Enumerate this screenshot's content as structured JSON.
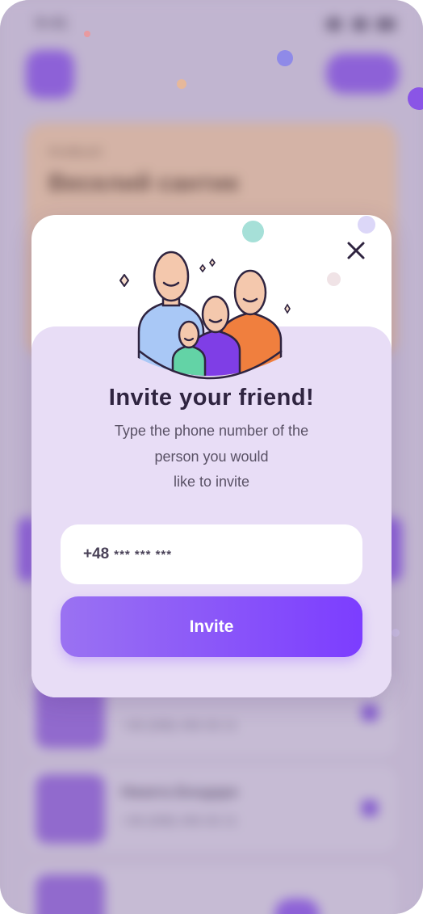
{
  "background": {
    "status_time": "9:41",
    "card_subtitle": "Kindbush",
    "card_title": "Веселий сантик",
    "list": [
      {
        "name": "",
        "phone": "+38 (098) 456 00 21"
      },
      {
        "name": "Никита Бондаре",
        "phone": "+38 (098) 456 00 21"
      }
    ]
  },
  "modal": {
    "title": "Invite your friend!",
    "description_lines": [
      "Type the phone number of the",
      "person you would",
      "like to invite"
    ],
    "phone_prefix": "+48",
    "phone_mask": "*** *** ***",
    "invite_label": "Invite"
  },
  "colors": {
    "accent": "#7c3dff",
    "modal_lower": "#e8ddf6",
    "title_text": "#2f2440"
  },
  "icons": {
    "close": "close-icon",
    "illustration": "family-illustration"
  }
}
